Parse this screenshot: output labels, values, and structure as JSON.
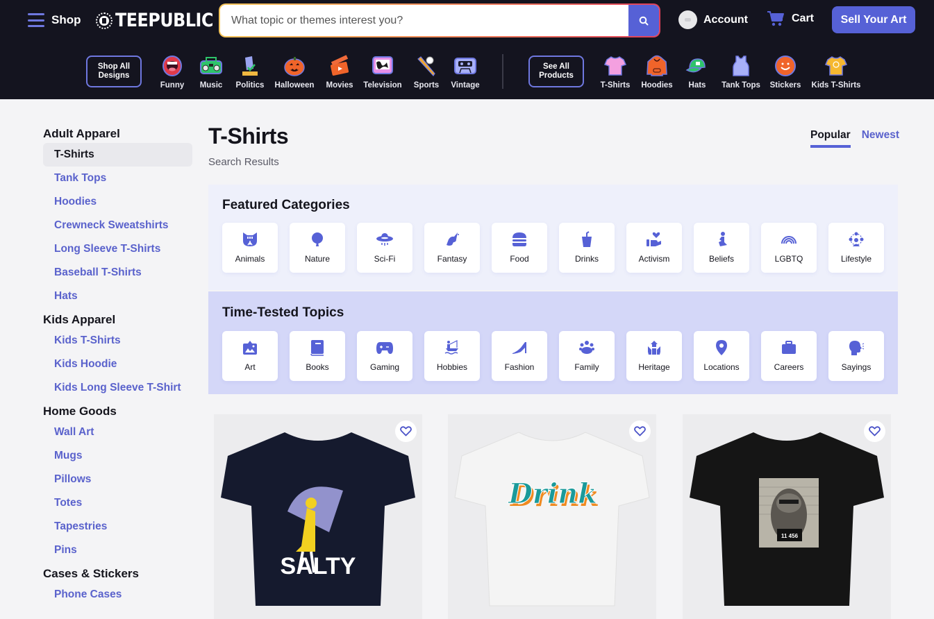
{
  "header": {
    "shop_label": "Shop",
    "logo_text": "TEEPUBLIC",
    "search_placeholder": "What topic or themes interest you?",
    "search_value": "",
    "account_label": "Account",
    "cart_label": "Cart",
    "sell_label": "Sell Your Art",
    "icons": {
      "menu": "hamburger-icon",
      "search": "magnifier-icon",
      "account": "avatar-icon",
      "cart": "cart-icon"
    }
  },
  "design_nav": {
    "shop_all_label_1": "Shop All",
    "shop_all_label_2": "Designs",
    "items": [
      {
        "label": "Funny",
        "icon": "laughing-mouth-icon"
      },
      {
        "label": "Music",
        "icon": "boombox-icon"
      },
      {
        "label": "Politics",
        "icon": "ballot-icon"
      },
      {
        "label": "Halloween",
        "icon": "pumpkin-icon"
      },
      {
        "label": "Movies",
        "icon": "clapperboard-icon"
      },
      {
        "label": "Television",
        "icon": "tv-icon"
      },
      {
        "label": "Sports",
        "icon": "baseball-bat-icon"
      },
      {
        "label": "Vintage",
        "icon": "cassette-icon"
      }
    ]
  },
  "product_nav": {
    "see_all_label_1": "See All",
    "see_all_label_2": "Products",
    "items": [
      {
        "label": "T-Shirts",
        "icon": "tshirt-icon"
      },
      {
        "label": "Hoodies",
        "icon": "hoodie-icon"
      },
      {
        "label": "Hats",
        "icon": "cap-icon"
      },
      {
        "label": "Tank Tops",
        "icon": "tank-top-icon"
      },
      {
        "label": "Stickers",
        "icon": "sticker-icon"
      },
      {
        "label": "Kids T-Shirts",
        "icon": "kids-tshirt-icon"
      }
    ]
  },
  "sidebar": {
    "groups": [
      {
        "heading": "Adult Apparel",
        "links": [
          "T-Shirts",
          "Tank Tops",
          "Hoodies",
          "Crewneck Sweatshirts",
          "Long Sleeve T-Shirts",
          "Baseball T-Shirts",
          "Hats"
        ],
        "active": "T-Shirts"
      },
      {
        "heading": "Kids Apparel",
        "links": [
          "Kids T-Shirts",
          "Kids Hoodie",
          "Kids Long Sleeve T-Shirt"
        ]
      },
      {
        "heading": "Home Goods",
        "links": [
          "Wall Art",
          "Mugs",
          "Pillows",
          "Totes",
          "Tapestries",
          "Pins"
        ]
      },
      {
        "heading": "Cases & Stickers",
        "links": [
          "Phone Cases"
        ]
      }
    ]
  },
  "main": {
    "title": "T-Shirts",
    "subtitle": "Search Results",
    "sort_tabs": [
      {
        "label": "Popular",
        "active": true
      },
      {
        "label": "Newest",
        "active": false
      }
    ],
    "featured": {
      "title": "Featured Categories",
      "items": [
        {
          "label": "Animals",
          "icon": "cat-face-icon"
        },
        {
          "label": "Nature",
          "icon": "tree-icon"
        },
        {
          "label": "Sci-Fi",
          "icon": "ufo-icon"
        },
        {
          "label": "Fantasy",
          "icon": "unicorn-icon"
        },
        {
          "label": "Food",
          "icon": "burger-icon"
        },
        {
          "label": "Drinks",
          "icon": "cup-straw-icon"
        },
        {
          "label": "Activism",
          "icon": "hand-heart-icon"
        },
        {
          "label": "Beliefs",
          "icon": "praying-person-icon"
        },
        {
          "label": "LGBTQ",
          "icon": "rainbow-icon"
        },
        {
          "label": "Lifestyle",
          "icon": "people-network-icon"
        }
      ]
    },
    "topics": {
      "title": "Time-Tested Topics",
      "items": [
        {
          "label": "Art",
          "icon": "picture-frame-icon"
        },
        {
          "label": "Books",
          "icon": "book-icon"
        },
        {
          "label": "Gaming",
          "icon": "gamepad-icon"
        },
        {
          "label": "Hobbies",
          "icon": "fishing-boat-icon"
        },
        {
          "label": "Fashion",
          "icon": "high-heel-icon"
        },
        {
          "label": "Family",
          "icon": "family-icon"
        },
        {
          "label": "Heritage",
          "icon": "heritage-hands-icon"
        },
        {
          "label": "Locations",
          "icon": "map-pin-icon"
        },
        {
          "label": "Careers",
          "icon": "briefcase-icon"
        },
        {
          "label": "Sayings",
          "icon": "speaking-head-icon"
        }
      ]
    },
    "products": [
      {
        "design_text": "SALTY",
        "shirt_color": "#151a2e",
        "design": "girl-with-umbrella"
      },
      {
        "design_text": "Drink",
        "shirt_color": "#f2f2f2",
        "design": "retro-script"
      },
      {
        "design_text": "11 456",
        "shirt_color": "#151515",
        "design": "raccoon-mugshot"
      }
    ]
  },
  "colors": {
    "header_bg": "#14141f",
    "accent": "#5661d6",
    "link": "#5a62cc",
    "featured_bg": "#eef0fb",
    "topics_bg": "#d4d7f8"
  }
}
